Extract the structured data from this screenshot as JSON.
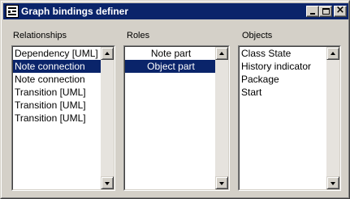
{
  "window": {
    "title": "Graph bindings definer",
    "icon": "app-icon",
    "controls": [
      "minimize-icon",
      "maximize-icon",
      "close-icon"
    ]
  },
  "relationships": {
    "label": "Relationships",
    "items": [
      "Dependency [UML]",
      "Note connection",
      "Note connection",
      "Transition [UML]",
      "Transition [UML]",
      "Transition [UML]"
    ],
    "selected_index": 1
  },
  "roles": {
    "label": "Roles",
    "items": [
      "Note part",
      "Object part"
    ],
    "selected_index": 1
  },
  "objects": {
    "label": "Objects",
    "items": [
      "Class State",
      "History indicator",
      "Package",
      "Start"
    ],
    "selected_index": -1
  },
  "colors": {
    "selection": "#0a246a",
    "face": "#d4d0c8"
  }
}
